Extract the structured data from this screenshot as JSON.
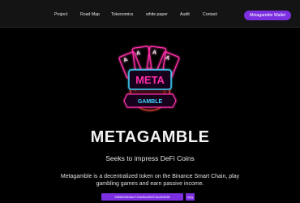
{
  "nav": {
    "items": [
      {
        "label": "Project"
      },
      {
        "label": "Road Map"
      },
      {
        "label": "Tokenomics"
      },
      {
        "label": "white paper"
      },
      {
        "label": "Audit"
      },
      {
        "label": "Contact"
      }
    ],
    "wallet_button": "Metagamble Wallet"
  },
  "logo": {
    "word_top": "META",
    "word_bottom": "GAMBLE",
    "card_rank": "A"
  },
  "hero": {
    "title": "METAGAMBLE",
    "subtitle": "Seeks to impress DeFi Coins",
    "description": "Metagamble is a decentralized token on the Binance Smart Chain, play gambling games and earn passive income.",
    "contract_address": "0xB5f2e6fb3eee7104e0be4f0b97d1c600f186",
    "copy_label": "copy"
  },
  "colors": {
    "background": "#000000",
    "topbar": "#141414",
    "accent": "#7b2fe0",
    "neon_pink": "#ff2fa8",
    "neon_blue": "#3fd6ff"
  }
}
